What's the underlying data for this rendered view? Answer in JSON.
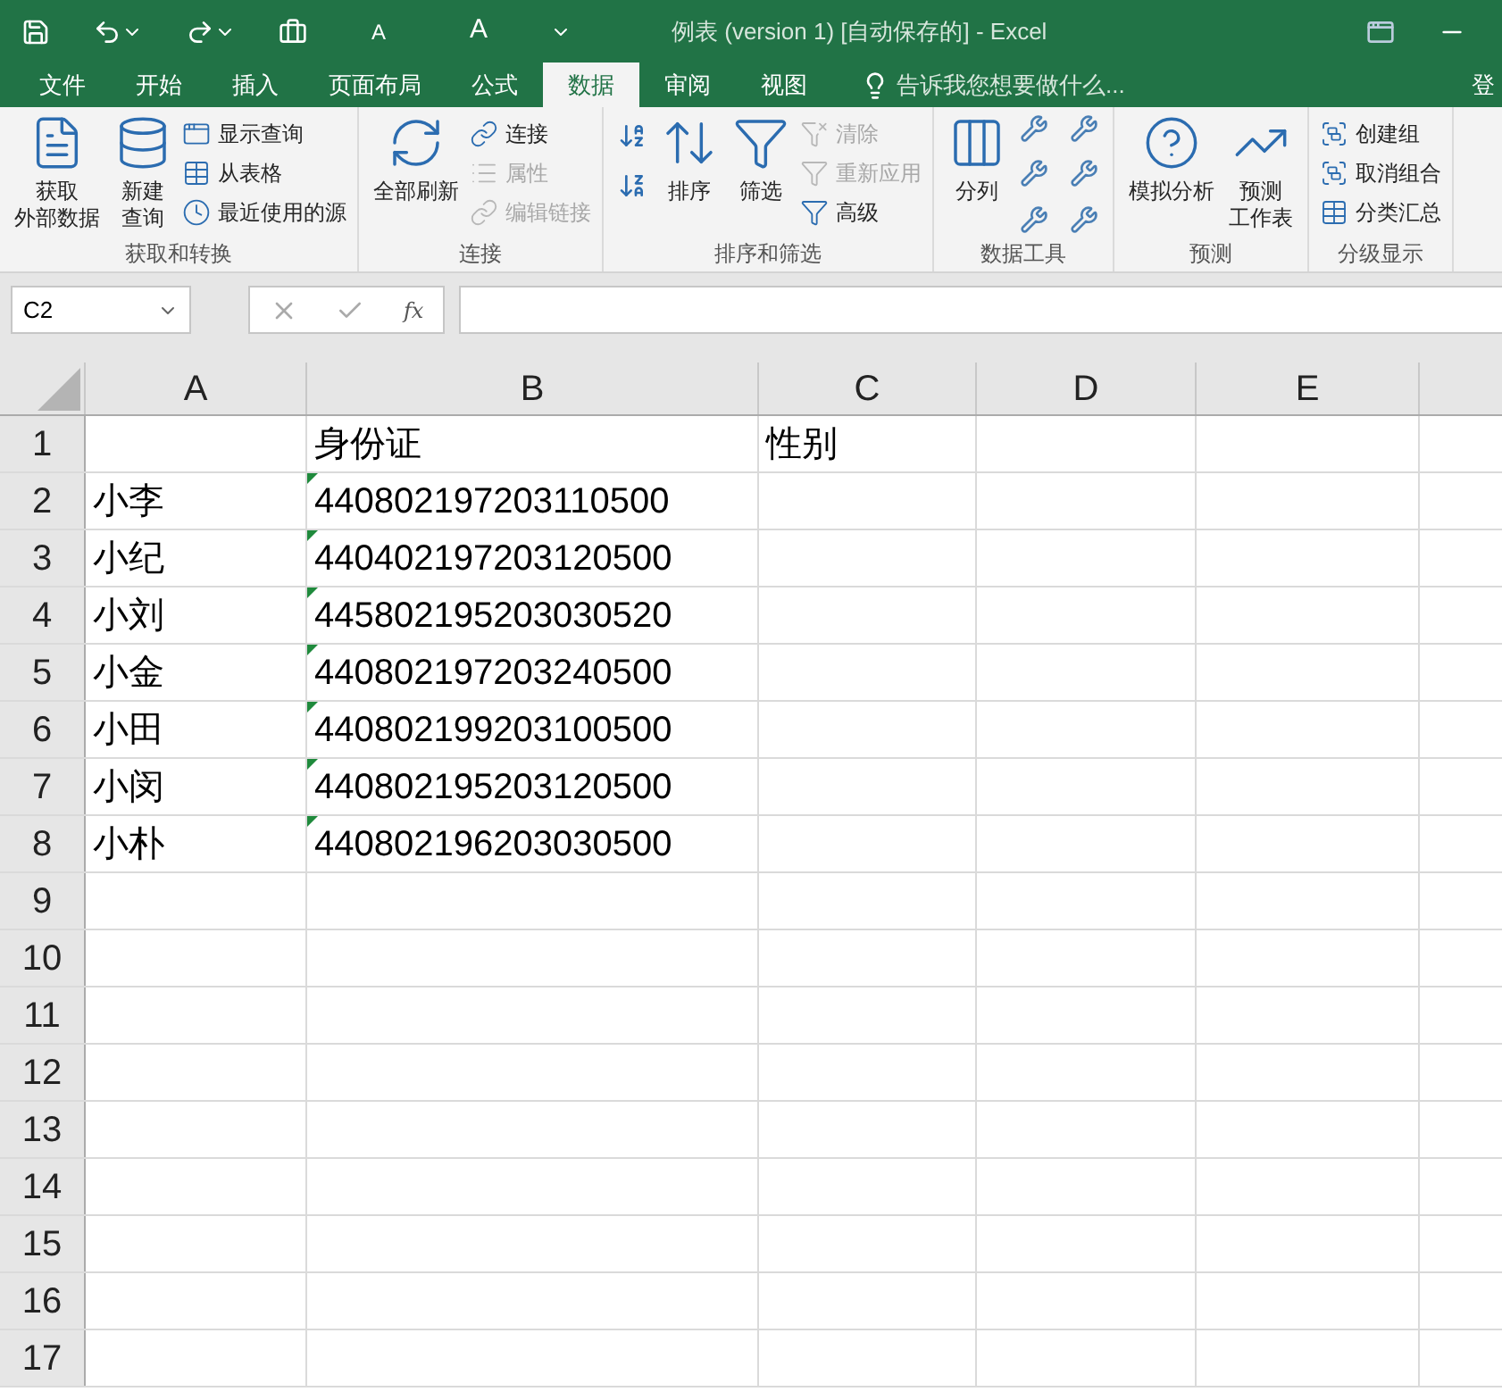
{
  "title_bar": {
    "title": "例表 (version 1) [自动保存的] - Excel",
    "font_buttons": [
      "A",
      "A"
    ]
  },
  "tabs": [
    {
      "label": "文件",
      "selected": false
    },
    {
      "label": "开始",
      "selected": false
    },
    {
      "label": "插入",
      "selected": false
    },
    {
      "label": "页面布局",
      "selected": false
    },
    {
      "label": "公式",
      "selected": false
    },
    {
      "label": "数据",
      "selected": true
    },
    {
      "label": "审阅",
      "selected": false
    },
    {
      "label": "视图",
      "selected": false
    }
  ],
  "tell_me": "告诉我您想要做什么...",
  "sign_in": "登",
  "ribbon": [
    {
      "label": "获取和转换",
      "buttons": [
        {
          "kind": "large",
          "lines": [
            "获取",
            "外部数据"
          ],
          "disabled": false
        },
        {
          "kind": "large",
          "lines": [
            "新建",
            "查询"
          ],
          "disabled": false
        },
        {
          "kind": "small",
          "lines": [
            "显示查询"
          ],
          "disabled": false
        },
        {
          "kind": "small",
          "lines": [
            "从表格"
          ],
          "disabled": false
        },
        {
          "kind": "small",
          "lines": [
            "最近使用的源"
          ],
          "disabled": false
        }
      ]
    },
    {
      "label": "连接",
      "buttons": [
        {
          "kind": "large",
          "lines": [
            "全部刷新"
          ],
          "disabled": false
        },
        {
          "kind": "small",
          "lines": [
            "连接"
          ],
          "disabled": false
        },
        {
          "kind": "small",
          "lines": [
            "属性"
          ],
          "disabled": true
        },
        {
          "kind": "small",
          "lines": [
            "编辑链接"
          ],
          "disabled": true
        }
      ]
    },
    {
      "label": "排序和筛选",
      "buttons": [
        {
          "kind": "icons",
          "disabled": false
        },
        {
          "kind": "large",
          "lines": [
            "排序"
          ],
          "disabled": false
        },
        {
          "kind": "large",
          "lines": [
            "筛选"
          ],
          "disabled": false
        },
        {
          "kind": "small",
          "lines": [
            "清除"
          ],
          "disabled": true
        },
        {
          "kind": "small",
          "lines": [
            "重新应用"
          ],
          "disabled": true
        },
        {
          "kind": "small",
          "lines": [
            "高级"
          ],
          "disabled": false
        }
      ]
    },
    {
      "label": "数据工具",
      "buttons": [
        {
          "kind": "large",
          "lines": [
            "分列"
          ],
          "disabled": false
        },
        {
          "kind": "icons",
          "disabled": false
        }
      ]
    },
    {
      "label": "预测",
      "buttons": [
        {
          "kind": "large",
          "lines": [
            "模拟分析"
          ],
          "disabled": false
        },
        {
          "kind": "large",
          "lines": [
            "预测",
            "工作表"
          ],
          "disabled": false
        }
      ]
    },
    {
      "label": "分级显示",
      "buttons": [
        {
          "kind": "small",
          "lines": [
            "创建组"
          ],
          "disabled": false
        },
        {
          "kind": "small",
          "lines": [
            "取消组合"
          ],
          "disabled": false
        },
        {
          "kind": "small",
          "lines": [
            "分类汇总"
          ],
          "disabled": false
        }
      ]
    }
  ],
  "name_box": "C2",
  "function_label": "fx",
  "columns": [
    "A",
    "B",
    "C",
    "D",
    "E"
  ],
  "rows": [
    {
      "header": "1",
      "b": {
        "text": "身份证",
        "warning": false
      },
      "c": {
        "text": "性别",
        "warning": false
      }
    },
    {
      "header": "2",
      "a": {
        "text": "小李",
        "warning": false
      },
      "b": {
        "text": "440802197203110500",
        "warning": true
      }
    },
    {
      "header": "3",
      "a": {
        "text": "小纪",
        "warning": false
      },
      "b": {
        "text": "440402197203120500",
        "warning": true
      }
    },
    {
      "header": "4",
      "a": {
        "text": "小刘",
        "warning": false
      },
      "b": {
        "text": "445802195203030520",
        "warning": true
      }
    },
    {
      "header": "5",
      "a": {
        "text": "小金",
        "warning": false
      },
      "b": {
        "text": "440802197203240500",
        "warning": true
      }
    },
    {
      "header": "6",
      "a": {
        "text": "小田",
        "warning": false
      },
      "b": {
        "text": "440802199203100500",
        "warning": true
      }
    },
    {
      "header": "7",
      "a": {
        "text": "小闵",
        "warning": false
      },
      "b": {
        "text": "440802195203120500",
        "warning": true
      }
    },
    {
      "header": "8",
      "a": {
        "text": "小朴",
        "warning": false
      },
      "b": {
        "text": "440802196203030500",
        "warning": true
      }
    },
    {
      "header": "9"
    },
    {
      "header": "10"
    },
    {
      "header": "11"
    },
    {
      "header": "12"
    },
    {
      "header": "13"
    },
    {
      "header": "14"
    },
    {
      "header": "15"
    },
    {
      "header": "16"
    },
    {
      "header": "17"
    }
  ]
}
